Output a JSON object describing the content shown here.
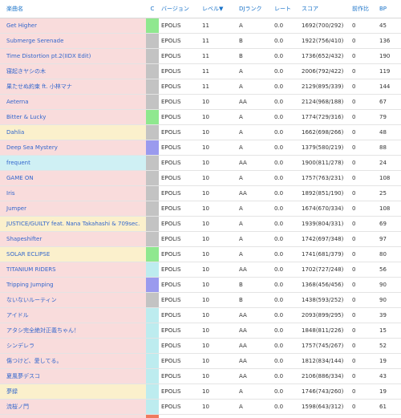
{
  "header": {
    "title": "楽曲名",
    "clear": "C",
    "version": "バージョン",
    "level": "レベル▼",
    "djrank": "DJランク",
    "rate": "レート",
    "score": "スコア",
    "prev": "前作比",
    "bp": "BP"
  },
  "colors": {
    "pink": "#f9dcdc",
    "yellow": "#fbf0cc",
    "cyan": "#cff0f4",
    "lamp_green": "#8fe88f",
    "lamp_gray": "#c3c3c3",
    "lamp_blue": "#9a9aee",
    "lamp_cyan": "#bdecef",
    "lamp_red": "#ef7a5e"
  },
  "rows": [
    {
      "title": "Get Higher",
      "bg": "pink",
      "lamp": "green",
      "version": "EPOLIS",
      "level": "11",
      "dj": "A",
      "rate": "0.0",
      "score": "1692(700/292)",
      "prev": "0",
      "bp": "45"
    },
    {
      "title": "Submerge Serenade",
      "bg": "pink",
      "lamp": "gray",
      "version": "EPOLIS",
      "level": "11",
      "dj": "B",
      "rate": "0.0",
      "score": "1922(756/410)",
      "prev": "0",
      "bp": "136"
    },
    {
      "title": "Time Distortion pt.2(IIDX Edit)",
      "bg": "pink",
      "lamp": "gray",
      "version": "EPOLIS",
      "level": "11",
      "dj": "B",
      "rate": "0.0",
      "score": "1736(652/432)",
      "prev": "0",
      "bp": "190"
    },
    {
      "title": "寝起きヤシの木",
      "bg": "pink",
      "lamp": "gray",
      "version": "EPOLIS",
      "level": "11",
      "dj": "A",
      "rate": "0.0",
      "score": "2006(792/422)",
      "prev": "0",
      "bp": "119"
    },
    {
      "title": "果たせぬ約束 ft. 小林マナ",
      "bg": "pink",
      "lamp": "gray",
      "version": "EPOLIS",
      "level": "11",
      "dj": "A",
      "rate": "0.0",
      "score": "2129(895/339)",
      "prev": "0",
      "bp": "144"
    },
    {
      "title": "Aeterna",
      "bg": "pink",
      "lamp": "gray",
      "version": "EPOLIS",
      "level": "10",
      "dj": "AA",
      "rate": "0.0",
      "score": "2124(968/188)",
      "prev": "0",
      "bp": "67"
    },
    {
      "title": "Bitter & Lucky",
      "bg": "pink",
      "lamp": "green",
      "version": "EPOLIS",
      "level": "10",
      "dj": "A",
      "rate": "0.0",
      "score": "1774(729/316)",
      "prev": "0",
      "bp": "79"
    },
    {
      "title": "Dahlia",
      "bg": "yellow",
      "lamp": "gray",
      "version": "EPOLIS",
      "level": "10",
      "dj": "A",
      "rate": "0.0",
      "score": "1662(698/266)",
      "prev": "0",
      "bp": "48"
    },
    {
      "title": "Deep Sea Mystery",
      "bg": "pink",
      "lamp": "blue",
      "version": "EPOLIS",
      "level": "10",
      "dj": "A",
      "rate": "0.0",
      "score": "1379(580/219)",
      "prev": "0",
      "bp": "88"
    },
    {
      "title": "frequent",
      "bg": "cyan",
      "lamp": "gray",
      "version": "EPOLIS",
      "level": "10",
      "dj": "AA",
      "rate": "0.0",
      "score": "1900(811/278)",
      "prev": "0",
      "bp": "24"
    },
    {
      "title": "GAME ON",
      "bg": "pink",
      "lamp": "gray",
      "version": "EPOLIS",
      "level": "10",
      "dj": "A",
      "rate": "0.0",
      "score": "1757(763/231)",
      "prev": "0",
      "bp": "108"
    },
    {
      "title": "Iris",
      "bg": "pink",
      "lamp": "gray",
      "version": "EPOLIS",
      "level": "10",
      "dj": "AA",
      "rate": "0.0",
      "score": "1892(851/190)",
      "prev": "0",
      "bp": "25"
    },
    {
      "title": "Jumper",
      "bg": "pink",
      "lamp": "gray",
      "version": "EPOLIS",
      "level": "10",
      "dj": "A",
      "rate": "0.0",
      "score": "1674(670/334)",
      "prev": "0",
      "bp": "108"
    },
    {
      "title": "JUSTICE/GUILTY feat. Nana Takahashi & 709sec.",
      "bg": "yellow",
      "lamp": "gray",
      "version": "EPOLIS",
      "level": "10",
      "dj": "A",
      "rate": "0.0",
      "score": "1939(804/331)",
      "prev": "0",
      "bp": "69"
    },
    {
      "title": "Shapeshifter",
      "bg": "pink",
      "lamp": "gray",
      "version": "EPOLIS",
      "level": "10",
      "dj": "A",
      "rate": "0.0",
      "score": "1742(697/348)",
      "prev": "0",
      "bp": "97"
    },
    {
      "title": "SOLAR ECLIPSE",
      "bg": "yellow",
      "lamp": "green",
      "version": "EPOLIS",
      "level": "10",
      "dj": "A",
      "rate": "0.0",
      "score": "1741(681/379)",
      "prev": "0",
      "bp": "80"
    },
    {
      "title": "TITANIUM RIDERS",
      "bg": "pink",
      "lamp": "cyan",
      "version": "EPOLIS",
      "level": "10",
      "dj": "AA",
      "rate": "0.0",
      "score": "1702(727/248)",
      "prev": "0",
      "bp": "56"
    },
    {
      "title": "Tripping Jumping",
      "bg": "pink",
      "lamp": "blue",
      "version": "EPOLIS",
      "level": "10",
      "dj": "B",
      "rate": "0.0",
      "score": "1368(456/456)",
      "prev": "0",
      "bp": "90"
    },
    {
      "title": "ないないルーティン",
      "bg": "pink",
      "lamp": "gray",
      "version": "EPOLIS",
      "level": "10",
      "dj": "B",
      "rate": "0.0",
      "score": "1438(593/252)",
      "prev": "0",
      "bp": "90"
    },
    {
      "title": "アイドル",
      "bg": "pink",
      "lamp": "cyan",
      "version": "EPOLIS",
      "level": "10",
      "dj": "AA",
      "rate": "0.0",
      "score": "2093(899/295)",
      "prev": "0",
      "bp": "39"
    },
    {
      "title": "アタシ完全絶対正義ちゃん！",
      "bg": "pink",
      "lamp": "cyan",
      "version": "EPOLIS",
      "level": "10",
      "dj": "AA",
      "rate": "0.0",
      "score": "1848(811/226)",
      "prev": "0",
      "bp": "15"
    },
    {
      "title": "シンデレラ",
      "bg": "pink",
      "lamp": "cyan",
      "version": "EPOLIS",
      "level": "10",
      "dj": "AA",
      "rate": "0.0",
      "score": "1757(745/267)",
      "prev": "0",
      "bp": "52"
    },
    {
      "title": "傷つけど、愛してる。",
      "bg": "pink",
      "lamp": "cyan",
      "version": "EPOLIS",
      "level": "10",
      "dj": "AA",
      "rate": "0.0",
      "score": "1812(834/144)",
      "prev": "0",
      "bp": "19"
    },
    {
      "title": "夏風夢デスコ",
      "bg": "pink",
      "lamp": "cyan",
      "version": "EPOLIS",
      "level": "10",
      "dj": "AA",
      "rate": "0.0",
      "score": "2106(886/334)",
      "prev": "0",
      "bp": "43"
    },
    {
      "title": "夢録",
      "bg": "yellow",
      "lamp": "cyan",
      "version": "EPOLIS",
      "level": "10",
      "dj": "A",
      "rate": "0.0",
      "score": "1746(743/260)",
      "prev": "0",
      "bp": "19"
    },
    {
      "title": "流桜ノ門",
      "bg": "pink",
      "lamp": "cyan",
      "version": "EPOLIS",
      "level": "10",
      "dj": "A",
      "rate": "0.0",
      "score": "1598(643/312)",
      "prev": "0",
      "bp": "61"
    }
  ],
  "partial_row": {
    "bg": "pink",
    "lamp": "red"
  }
}
